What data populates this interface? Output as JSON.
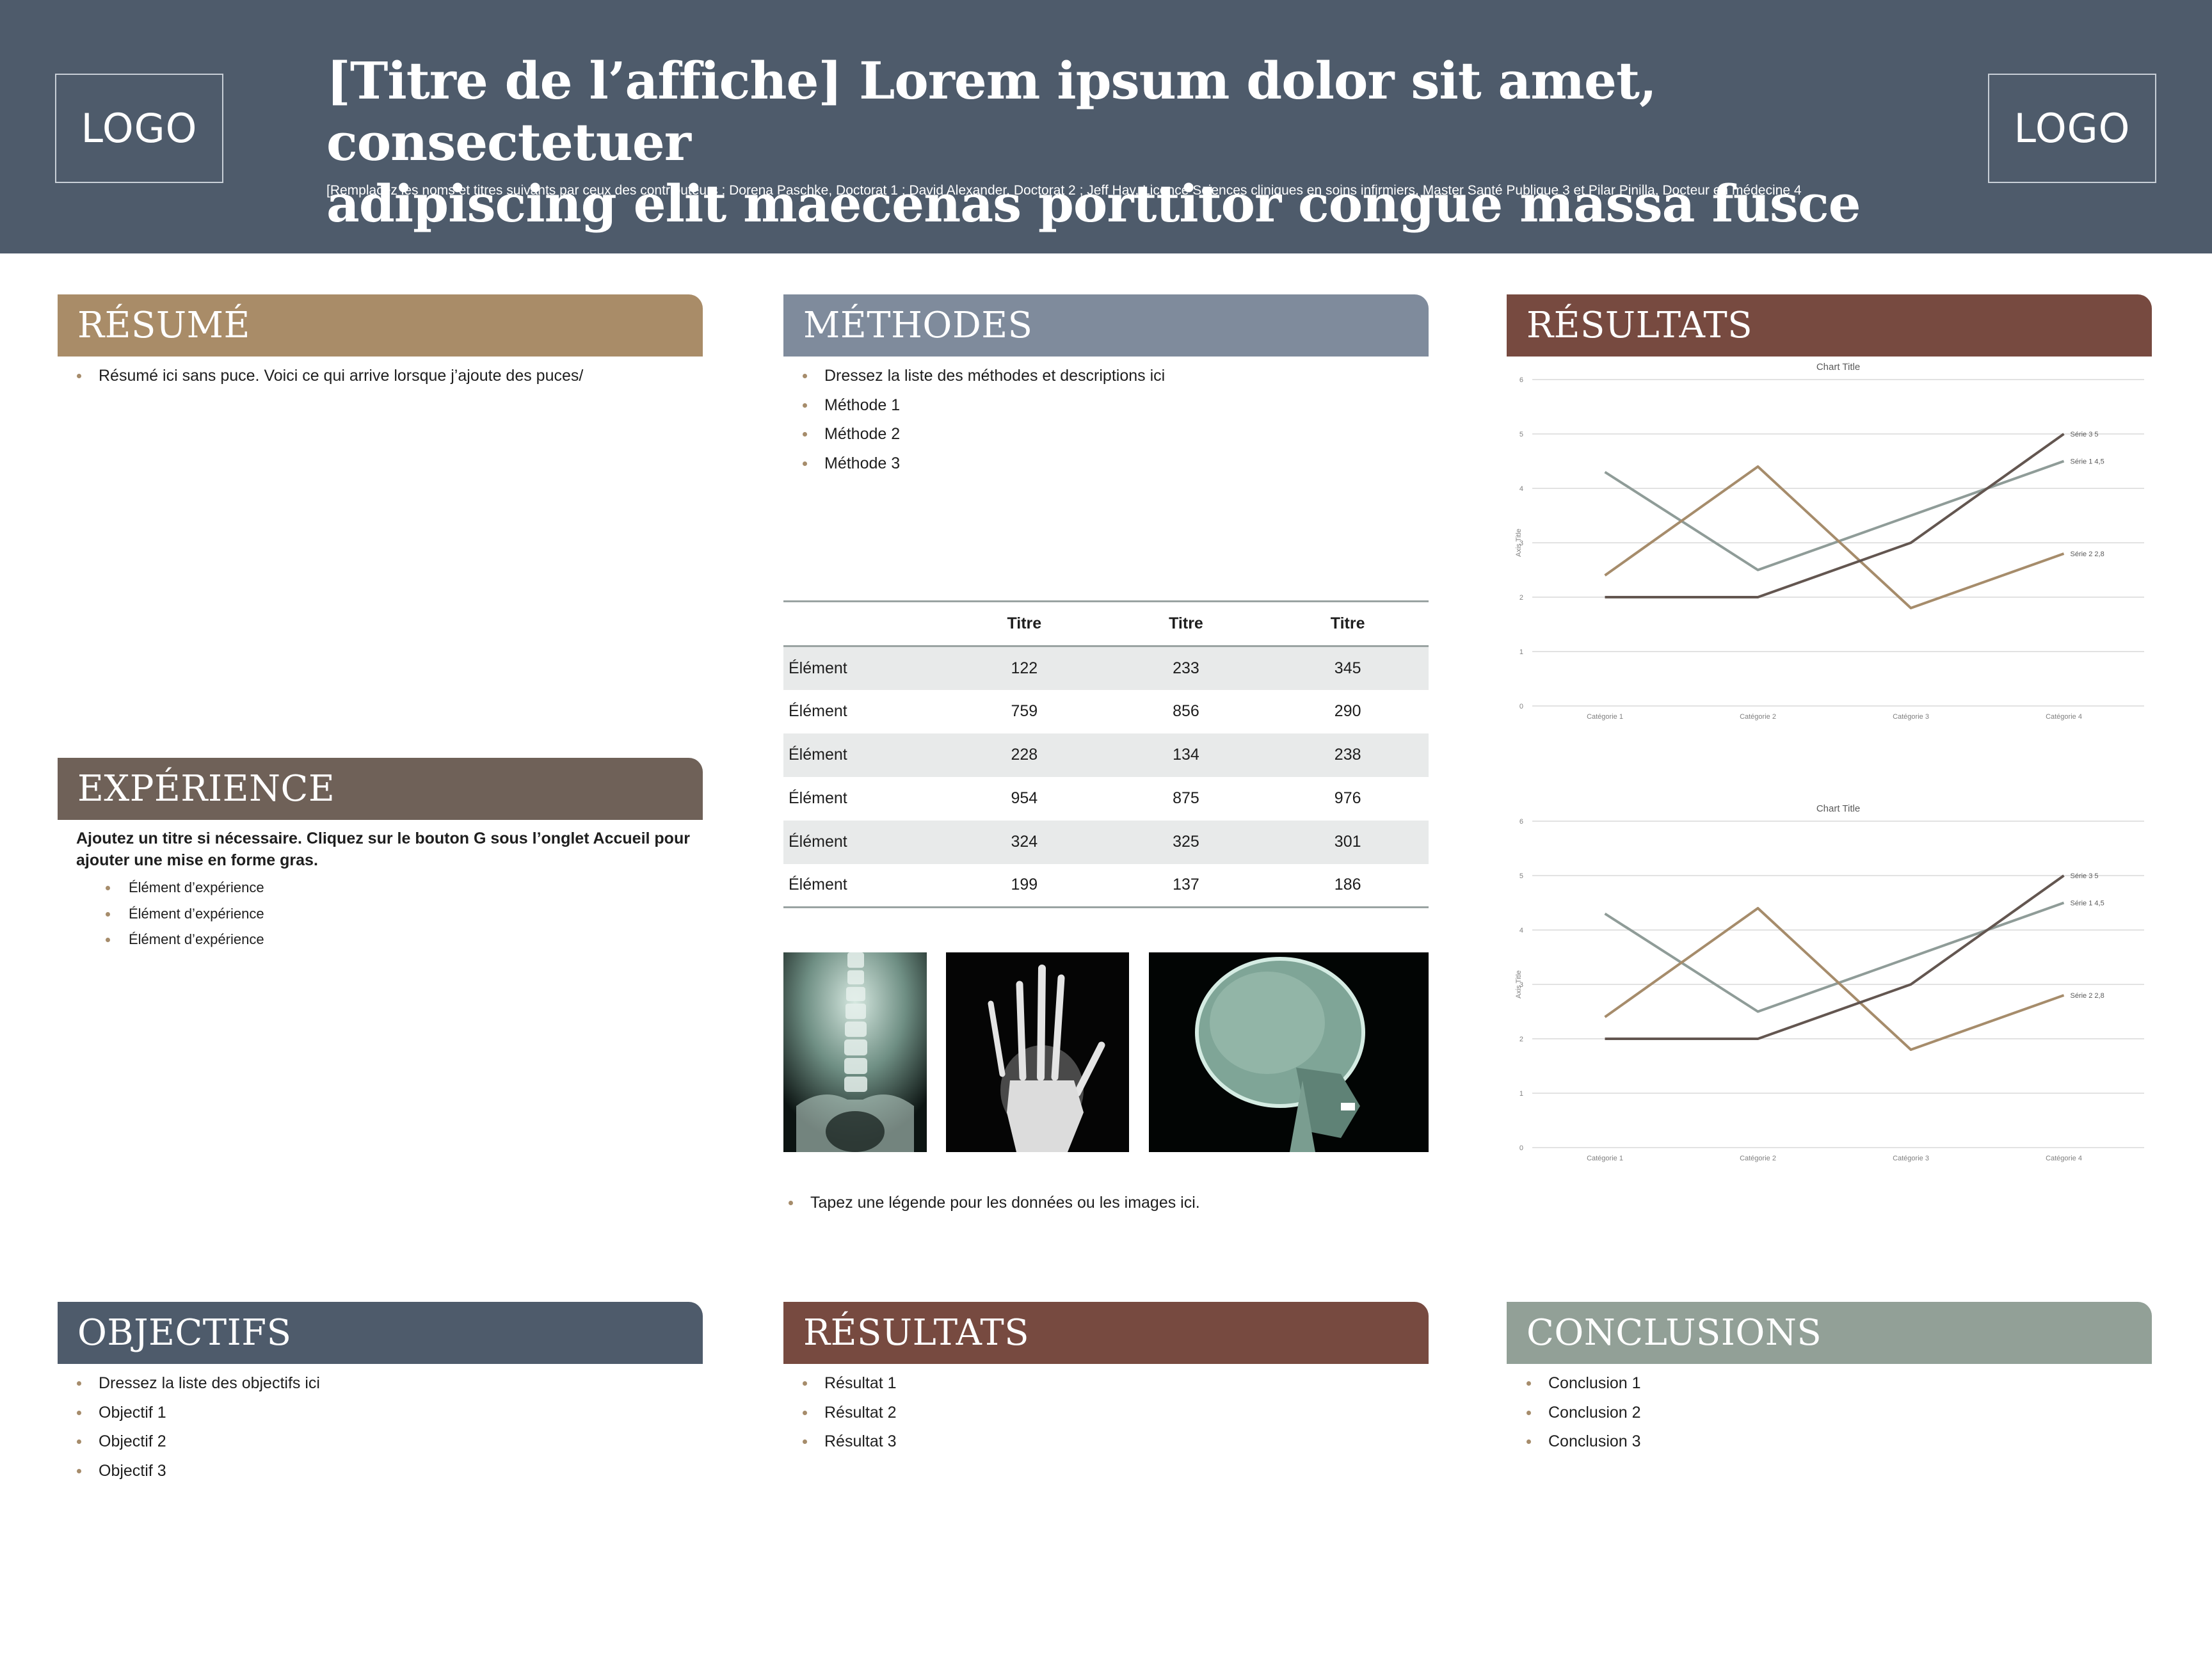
{
  "header": {
    "logo_left": "LOGO",
    "logo_right": "LOGO",
    "title_line1": "[Titre de l’affiche] Lorem ipsum dolor sit amet, consectetuer",
    "title_line2": "adipiscing elit maecenas porttitor congue massa fusce",
    "authors": "[Remplacez les noms et titres suivants par ceux des contributeurs : Dorena Paschke, Doctorat 1 ; David Alexander, Doctorat 2 ;  Jeff Hay, Licence Sciences cliniques en soins infirmiers, Master Santé Publique 3 et Pilar Pinilla, Docteur en médecine 4",
    "color": "#4e5b6b"
  },
  "sections": {
    "resume": {
      "title": "RÉSUMÉ",
      "color": "#a98c68",
      "items": [
        "Résumé ici sans puce. Voici ce qui arrive lorsque j’ajoute des puces/"
      ]
    },
    "experience": {
      "title": "EXPÉRIENCE",
      "color": "#6f6158",
      "note": "Ajoutez un titre si nécessaire. Cliquez sur le bouton G sous l’onglet Accueil pour ajouter une mise en forme gras.",
      "items": [
        "Élément d’expérience",
        "Élément d’expérience",
        "Élément d’expérience"
      ]
    },
    "objectifs": {
      "title": "OBJECTIFS",
      "color": "#4e5b6b",
      "items": [
        "Dressez la liste des objectifs ici",
        "Objectif 1",
        "Objectif 2",
        "Objectif 3"
      ]
    },
    "methodes": {
      "title": "MÉTHODES",
      "color": "#7f8b9c",
      "items": [
        "Dressez la liste des méthodes et descriptions ici",
        "Méthode 1",
        "Méthode 2",
        "Méthode 3"
      ]
    },
    "resultats_bottom": {
      "title": "RÉSULTATS",
      "color": "#774a40",
      "items": [
        "Résultat 1",
        "Résultat 2",
        "Résultat 3"
      ]
    },
    "resultats_top": {
      "title": "RÉSULTATS",
      "color": "#774a40"
    },
    "conclusions": {
      "title": "CONCLUSIONS",
      "color": "#92a097",
      "items": [
        "Conclusion 1",
        "Conclusion 2",
        "Conclusion 3"
      ]
    }
  },
  "table": {
    "headers": [
      "",
      "Titre",
      "Titre",
      "Titre"
    ],
    "rows": [
      [
        "Élément",
        "122",
        "233",
        "345"
      ],
      [
        "Élément",
        "759",
        "856",
        "290"
      ],
      [
        "Élément",
        "228",
        "134",
        "238"
      ],
      [
        "Élément",
        "954",
        "875",
        "976"
      ],
      [
        "Élément",
        "324",
        "325",
        "301"
      ],
      [
        "Élément",
        "199",
        "137",
        "186"
      ]
    ]
  },
  "images": [
    {
      "subject": "spine-xray"
    },
    {
      "subject": "hand-xray"
    },
    {
      "subject": "skull-xray"
    }
  ],
  "caption": "Tapez une légende pour les données ou les images ici.",
  "chart_data": [
    {
      "type": "line",
      "title": "Chart Title",
      "xlabel": "",
      "ylabel": "Axis Title",
      "ylim": [
        0,
        6
      ],
      "yticks": [
        0,
        1,
        2,
        3,
        4,
        5,
        6
      ],
      "grid": true,
      "legend": "none",
      "categories": [
        "Catégorie 1",
        "Catégorie 2",
        "Catégorie 3",
        "Catégorie 4"
      ],
      "series": [
        {
          "name": "Série 1",
          "values": [
            4.3,
            2.5,
            3.5,
            4.5
          ],
          "color": "#8f9c98",
          "end_label": "Série 1  4,5"
        },
        {
          "name": "Série 2",
          "values": [
            2.4,
            4.4,
            1.8,
            2.8
          ],
          "color": "#a68c6b",
          "end_label": "Série 2  2,8"
        },
        {
          "name": "Série 3",
          "values": [
            2,
            2,
            3,
            5
          ],
          "color": "#635650",
          "end_label": "Série 3  5"
        }
      ]
    },
    {
      "type": "line",
      "title": "Chart Title",
      "xlabel": "",
      "ylabel": "Axis Title",
      "ylim": [
        0,
        6
      ],
      "yticks": [
        0,
        1,
        2,
        3,
        4,
        5,
        6
      ],
      "grid": true,
      "legend": "none",
      "categories": [
        "Catégorie 1",
        "Catégorie 2",
        "Catégorie 3",
        "Catégorie 4"
      ],
      "series": [
        {
          "name": "Série 1",
          "values": [
            4.3,
            2.5,
            3.5,
            4.5
          ],
          "color": "#8f9c98",
          "end_label": "Série 1  4,5"
        },
        {
          "name": "Série 2",
          "values": [
            2.4,
            4.4,
            1.8,
            2.8
          ],
          "color": "#a68c6b",
          "end_label": "Série 2  2,8"
        },
        {
          "name": "Série 3",
          "values": [
            2,
            2,
            3,
            5
          ],
          "color": "#635650",
          "end_label": "Série 3  5"
        }
      ]
    }
  ]
}
